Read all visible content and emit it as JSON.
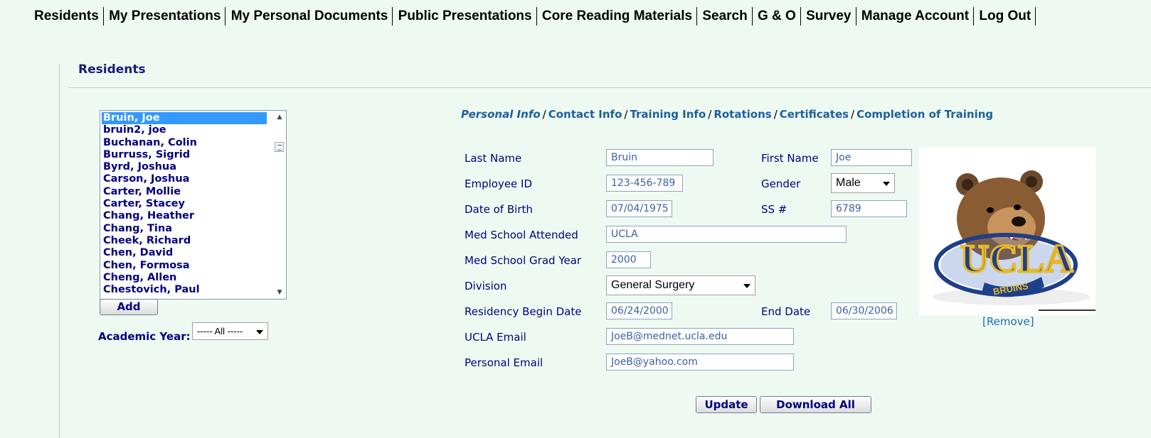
{
  "nav": [
    "Residents",
    "My Presentations",
    "My Personal Documents",
    "Public Presentations",
    "Core Reading Materials",
    "Search",
    "G & O",
    "Survey",
    "Manage Account",
    "Log Out"
  ],
  "section_title": "Residents",
  "residents": [
    "Bruin, Joe",
    "bruin2, joe",
    "Buchanan, Colin",
    "Burruss, Sigrid",
    "Byrd, Joshua",
    "Carson, Joshua",
    "Carter, Mollie",
    "Carter, Stacey",
    "Chang, Heather",
    "Chang, Tina",
    "Cheek, Richard",
    "Chen, David",
    "Chen, Formosa",
    "Cheng, Allen",
    "Chestovich, Paul"
  ],
  "selected_resident": "Bruin, Joe",
  "add_label": "Add",
  "academic_year": {
    "label": "Academic Year:",
    "value": "----- All -----"
  },
  "tabs": [
    "Personal Info",
    "Contact Info",
    "Training Info",
    "Rotations",
    "Certificates",
    "Completion of Training"
  ],
  "tab_sep": "/",
  "active_tab": "Personal Info",
  "form": {
    "last_name": {
      "label": "Last Name",
      "value": "Bruin"
    },
    "first_name": {
      "label": "First Name",
      "value": "Joe"
    },
    "employee_id": {
      "label": "Employee ID",
      "value": "123-456-789"
    },
    "gender": {
      "label": "Gender",
      "value": "Male"
    },
    "dob": {
      "label": "Date of Birth",
      "value": "07/04/1975"
    },
    "ssn": {
      "label": "SS #",
      "value": "6789"
    },
    "med_school": {
      "label": "Med School Attended",
      "value": "UCLA"
    },
    "grad_year": {
      "label": "Med School Grad Year",
      "value": "2000"
    },
    "division": {
      "label": "Division",
      "value": "General Surgery"
    },
    "residency_begin": {
      "label": "Residency Begin Date",
      "value": "06/24/2000"
    },
    "end_date": {
      "label": "End Date",
      "value": "06/30/2006"
    },
    "ucla_email": {
      "label": "UCLA Email",
      "value": "JoeB@mednet.ucla.edu"
    },
    "personal_email": {
      "label": "Personal Email",
      "value": "JoeB@yahoo.com"
    }
  },
  "photo": {
    "logo_text": "UCLA",
    "logo_subtext": "BRUINS",
    "remove_label": "[Remove]"
  },
  "buttons": {
    "update": "Update",
    "download_all": "Download All"
  }
}
